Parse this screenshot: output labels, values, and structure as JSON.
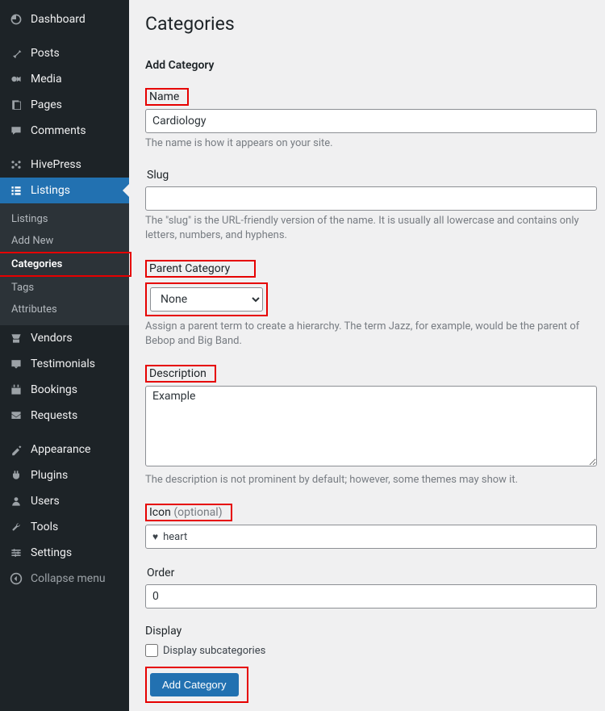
{
  "sidebar": {
    "items": [
      {
        "label": "Dashboard",
        "icon": "dashboard"
      },
      {
        "label": "Posts",
        "icon": "pin"
      },
      {
        "label": "Media",
        "icon": "media"
      },
      {
        "label": "Pages",
        "icon": "pages"
      },
      {
        "label": "Comments",
        "icon": "comments"
      },
      {
        "label": "HivePress",
        "icon": "hivepress"
      },
      {
        "label": "Listings",
        "icon": "listings",
        "active": true
      },
      {
        "label": "Vendors",
        "icon": "vendors"
      },
      {
        "label": "Testimonials",
        "icon": "testimonials"
      },
      {
        "label": "Bookings",
        "icon": "bookings"
      },
      {
        "label": "Requests",
        "icon": "requests"
      },
      {
        "label": "Appearance",
        "icon": "appearance"
      },
      {
        "label": "Plugins",
        "icon": "plugins"
      },
      {
        "label": "Users",
        "icon": "users"
      },
      {
        "label": "Tools",
        "icon": "tools"
      },
      {
        "label": "Settings",
        "icon": "settings"
      },
      {
        "label": "Collapse menu",
        "icon": "collapse"
      }
    ],
    "submenu": [
      {
        "label": "Listings"
      },
      {
        "label": "Add New"
      },
      {
        "label": "Categories",
        "current": true
      },
      {
        "label": "Tags"
      },
      {
        "label": "Attributes"
      }
    ]
  },
  "page": {
    "title": "Categories",
    "section": "Add Category"
  },
  "form": {
    "name_label": "Name",
    "name_value": "Cardiology",
    "name_desc": "The name is how it appears on your site.",
    "slug_label": "Slug",
    "slug_value": "",
    "slug_desc": "The \"slug\" is the URL-friendly version of the name. It is usually all lowercase and contains only letters, numbers, and hyphens.",
    "parent_label": "Parent Category",
    "parent_value": "None",
    "parent_desc": "Assign a parent term to create a hierarchy. The term Jazz, for example, would be the parent of Bebop and Big Band.",
    "desc_label": "Description",
    "desc_value": "Example",
    "desc_desc": "The description is not prominent by default; however, some themes may show it.",
    "icon_label": "Icon",
    "icon_optional": " (optional)",
    "icon_value": "heart",
    "order_label": "Order",
    "order_value": "0",
    "display_label": "Display",
    "display_checkbox_label": "Display subcategories",
    "submit_label": "Add Category"
  }
}
